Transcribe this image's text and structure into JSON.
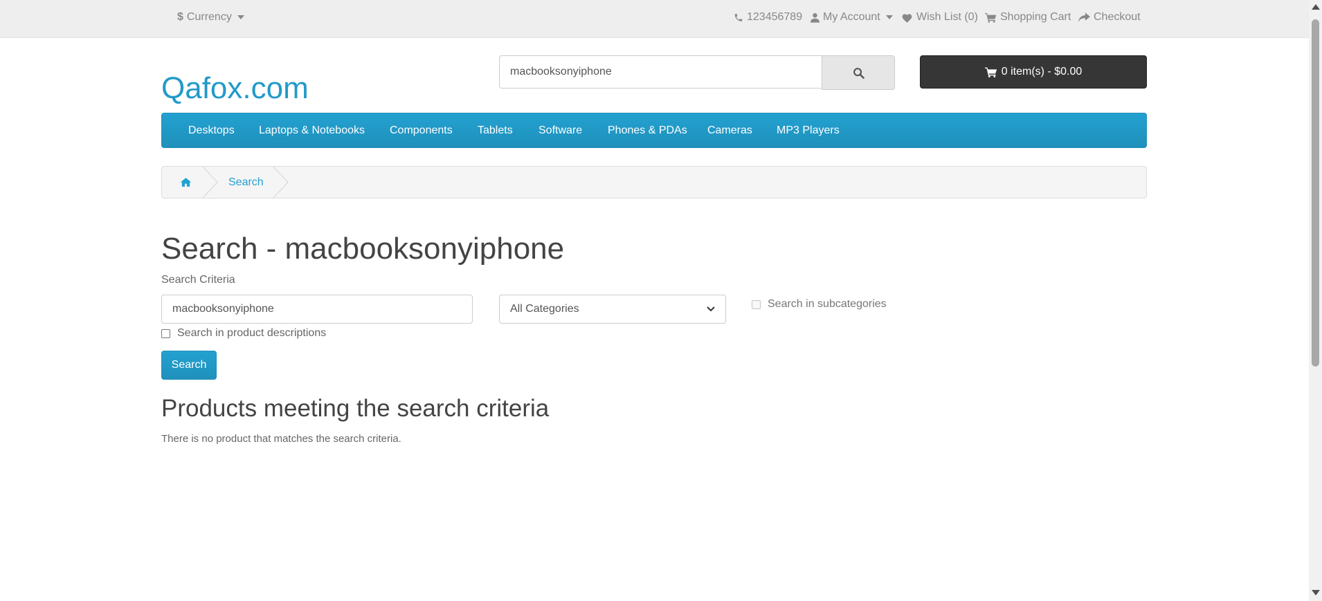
{
  "topbar": {
    "currency_label": "Currency",
    "currency_symbol": "$",
    "phone": "123456789",
    "my_account": "My Account",
    "wish_list": "Wish List (0)",
    "shopping_cart": "Shopping Cart",
    "checkout": "Checkout"
  },
  "header": {
    "logo": "Qafox.com",
    "search_value": "macbooksonyiphone",
    "cart_summary": "0 item(s) - $0.00"
  },
  "menu": {
    "items": [
      "Desktops",
      "Laptops & Notebooks",
      "Components",
      "Tablets",
      "Software",
      "Phones & PDAs",
      "Cameras",
      "MP3 Players"
    ]
  },
  "breadcrumb": {
    "search": "Search"
  },
  "content": {
    "title": "Search - macbooksonyiphone",
    "criteria_label": "Search Criteria",
    "criteria_value": "macbooksonyiphone",
    "category_selected": "All Categories",
    "subcategories_label": "Search in subcategories",
    "descriptions_label": "Search in product descriptions",
    "search_button": "Search",
    "results_heading": "Products meeting the search criteria",
    "no_results": "There is no product that matches the search criteria."
  },
  "colors": {
    "accent": "#229ac8",
    "menu_bg": "#229ac8",
    "cart_bg": "#363636",
    "topbar_bg": "#eeeeee"
  },
  "icons": {
    "phone": "phone-icon",
    "user": "user-icon",
    "heart": "heart-icon",
    "cart": "cart-icon",
    "share": "share-icon",
    "search": "search-icon",
    "home": "home-icon"
  }
}
